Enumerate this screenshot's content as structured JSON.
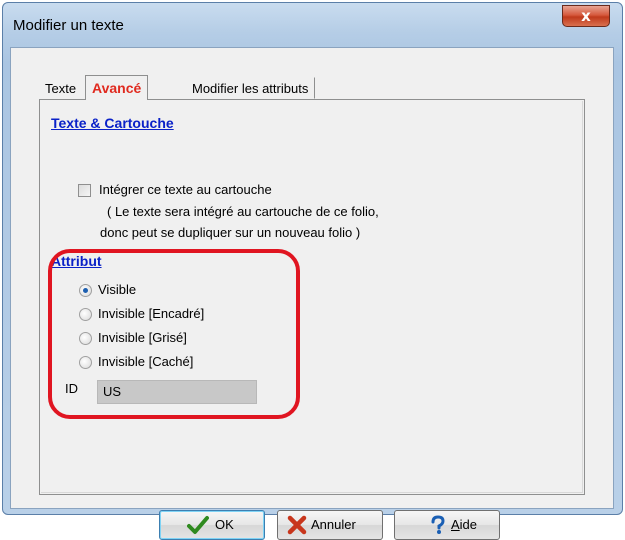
{
  "window": {
    "title": "Modifier un texte",
    "close_glyph": "x"
  },
  "tabs": [
    {
      "label": "Texte",
      "active": false
    },
    {
      "label": "Avancé",
      "active": true
    },
    {
      "label": "Modifier les attributs",
      "active": false
    }
  ],
  "texte_cartouche": {
    "title": "Texte & Cartouche",
    "checkbox_label": "Intégrer ce texte au cartouche",
    "checked": false,
    "note_line1": "( Le texte sera intégré au cartouche de ce folio,",
    "note_line2": "donc peut se dupliquer sur un nouveau folio )"
  },
  "attribut": {
    "title": "Attribut",
    "options": [
      {
        "label": "Visible",
        "selected": true
      },
      {
        "label": "Invisible [Encadré]",
        "selected": false
      },
      {
        "label": "Invisible [Grisé]",
        "selected": false
      },
      {
        "label": "Invisible [Caché]",
        "selected": false
      }
    ],
    "id_label": "ID",
    "id_value": "US"
  },
  "buttons": {
    "ok": {
      "label": "OK",
      "icon": "checkmark-icon"
    },
    "annuler": {
      "label": "Annuler",
      "icon": "x-icon"
    },
    "aide": {
      "label_prefix": "A",
      "label_rest": "ide",
      "icon": "question-icon"
    }
  },
  "colors": {
    "active_tab": "#e02a1f",
    "section_title": "#0a21c8",
    "highlight": "#e01521"
  }
}
